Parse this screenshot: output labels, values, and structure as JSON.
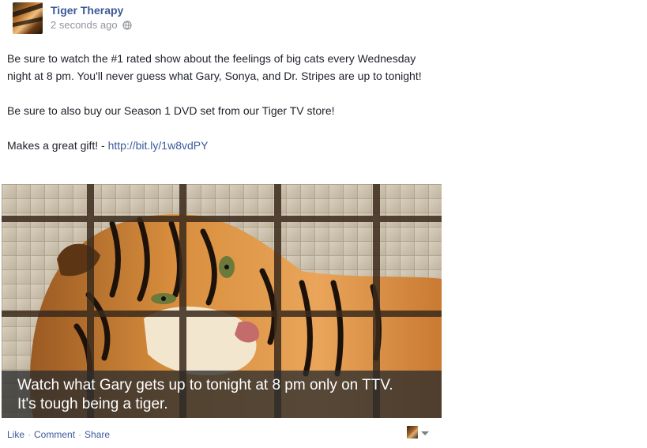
{
  "post": {
    "page_name": "Tiger Therapy",
    "timestamp": "2 seconds ago",
    "paragraphs": [
      "Be sure to watch the #1 rated show about the feelings of big cats every Wednesday night at 8 pm. You'll never guess what Gary, Sonya, and Dr. Stripes are up to tonight!",
      "Be sure to also buy our Season 1 DVD set from our Tiger TV store!"
    ],
    "gift_text": "Makes a great gift! - ",
    "link_text": "http://bit.ly/1w8vdPY",
    "photo": {
      "caption_line1": "Watch what Gary gets up to tonight at 8 pm only on TTV.",
      "caption_line2": "It's tough being a tiger."
    },
    "actions": {
      "like": "Like",
      "comment": "Comment",
      "share": "Share",
      "separator": "·"
    },
    "colors": {
      "link": "#3b5998",
      "text": "#1d2129",
      "meta": "#90949c",
      "caption_bg": "#2d2d2d"
    }
  }
}
